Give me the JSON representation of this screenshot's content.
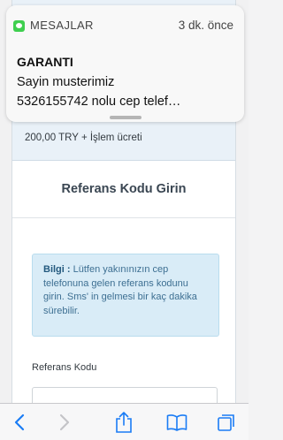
{
  "notification": {
    "app_name": "MESAJLAR",
    "time": "3 dk. önce",
    "title": "GARANTI",
    "line1": "Sayin musterimiz",
    "line2": "5326155742 nolu cep telef…"
  },
  "payment": {
    "amount_text": "200,00 TRY + İşlem ücreti"
  },
  "reference": {
    "title": "Referans Kodu Girin",
    "info_bold": "Bilgi :",
    "info_text": " Lütfen yakınınızın cep telefonuna gelen referans kodunu girin. Sms' in gelmesi bir kaç dakika sürebilir.",
    "field_label": "Referans Kodu",
    "field_value": ""
  },
  "toolbar": {
    "icons": [
      "back-icon",
      "forward-icon",
      "share-icon",
      "bookmarks-icon",
      "tabs-icon"
    ]
  },
  "colors": {
    "accent": "#1a7cf5",
    "info_bg": "#d9ecf7",
    "info_text": "#3d6f92"
  }
}
